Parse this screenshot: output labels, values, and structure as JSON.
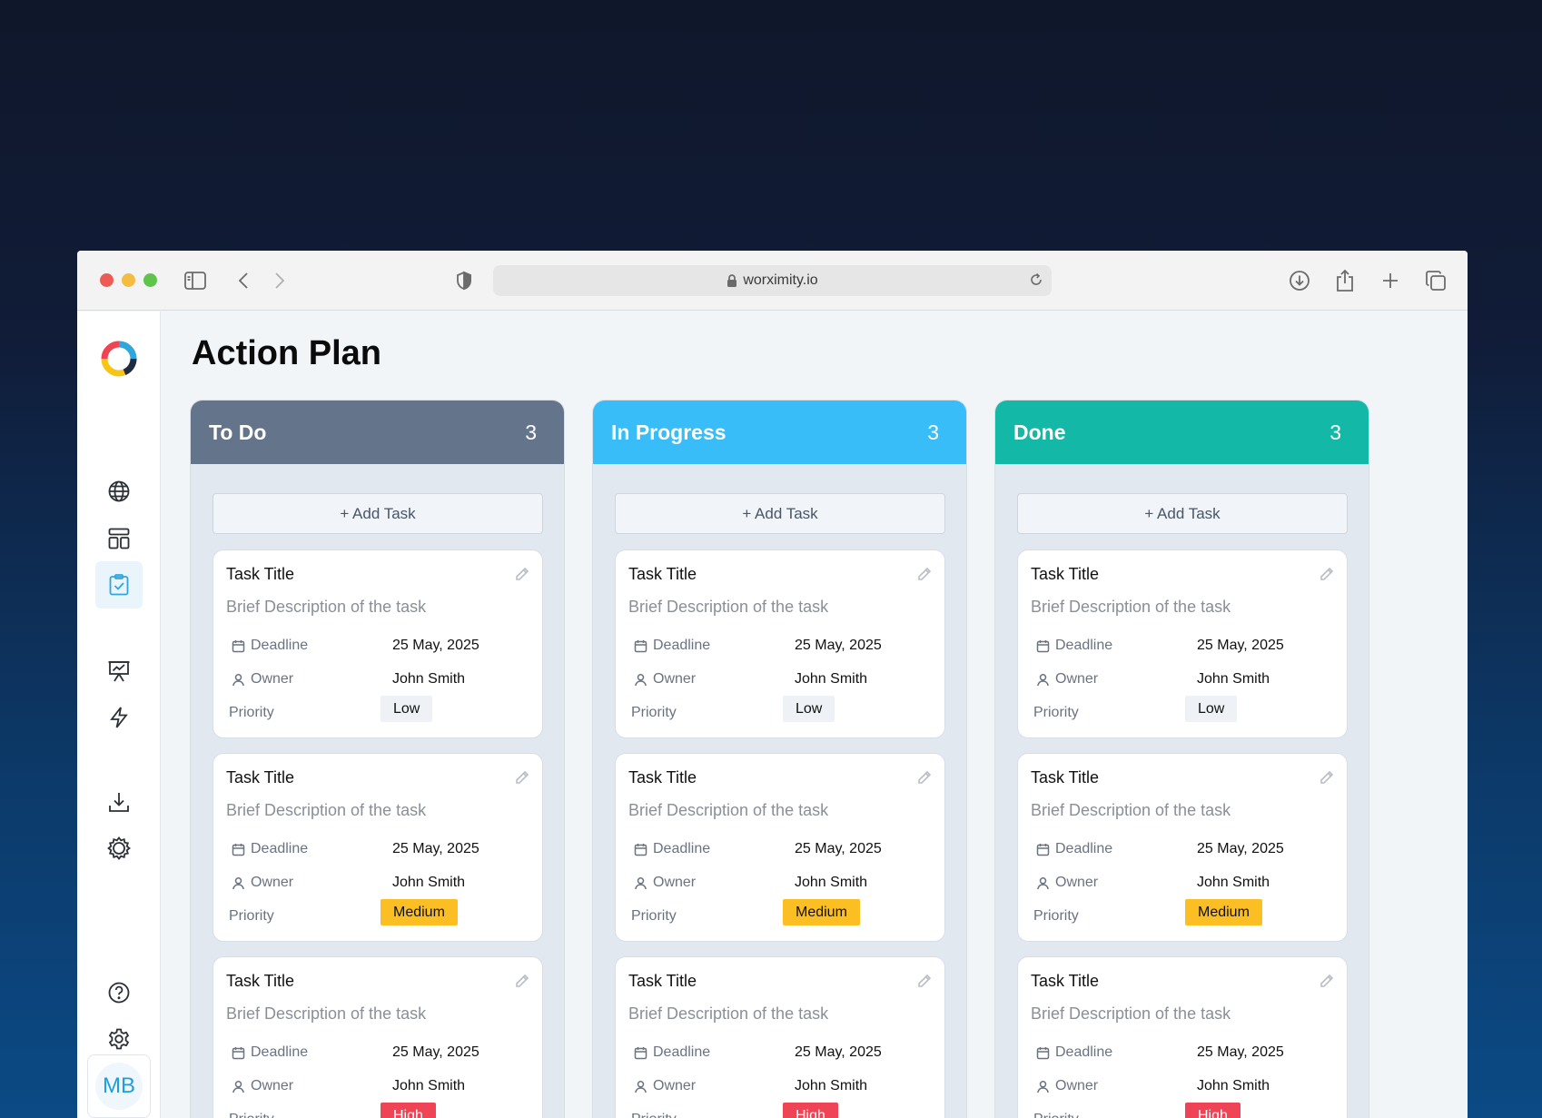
{
  "browser": {
    "url": "worximity.io"
  },
  "page": {
    "title": "Action Plan"
  },
  "user": {
    "initials": "MB"
  },
  "colors": {
    "todo": "#64748b",
    "in_progress": "#38bdf8",
    "done": "#14b8a6",
    "low": "#eef2f6",
    "medium": "#fbbf24",
    "high": "#ef4456"
  },
  "sidebar": {
    "items": [
      {
        "icon": "globe-icon"
      },
      {
        "icon": "layout-icon"
      },
      {
        "icon": "clipboard-check-icon",
        "active": true
      },
      {
        "icon": "presentation-chart-icon"
      },
      {
        "icon": "lightning-icon"
      },
      {
        "icon": "download-icon"
      },
      {
        "icon": "gear-badge-icon"
      },
      {
        "icon": "help-icon"
      },
      {
        "icon": "settings-icon"
      }
    ]
  },
  "columns": [
    {
      "name": "To Do",
      "count": "3",
      "add_label": "+ Add Task",
      "cards": [
        {
          "title": "Task Title",
          "description": "Brief Description of the task",
          "deadline_label": "Deadline",
          "deadline": "25 May, 2025",
          "owner_label": "Owner",
          "owner": "John Smith",
          "priority_label": "Priority",
          "priority": "Low"
        },
        {
          "title": "Task Title",
          "description": "Brief Description of the task",
          "deadline_label": "Deadline",
          "deadline": "25 May, 2025",
          "owner_label": "Owner",
          "owner": "John Smith",
          "priority_label": "Priority",
          "priority": "Medium"
        },
        {
          "title": "Task Title",
          "description": "Brief Description of the task",
          "deadline_label": "Deadline",
          "deadline": "25 May, 2025",
          "owner_label": "Owner",
          "owner": "John Smith",
          "priority_label": "Priority",
          "priority": "High"
        }
      ]
    },
    {
      "name": "In Progress",
      "count": "3",
      "add_label": "+ Add Task",
      "cards": [
        {
          "title": "Task Title",
          "description": "Brief Description of the task",
          "deadline_label": "Deadline",
          "deadline": "25 May, 2025",
          "owner_label": "Owner",
          "owner": "John Smith",
          "priority_label": "Priority",
          "priority": "Low"
        },
        {
          "title": "Task Title",
          "description": "Brief Description of the task",
          "deadline_label": "Deadline",
          "deadline": "25 May, 2025",
          "owner_label": "Owner",
          "owner": "John Smith",
          "priority_label": "Priority",
          "priority": "Medium"
        },
        {
          "title": "Task Title",
          "description": "Brief Description of the task",
          "deadline_label": "Deadline",
          "deadline": "25 May, 2025",
          "owner_label": "Owner",
          "owner": "John Smith",
          "priority_label": "Priority",
          "priority": "High"
        }
      ]
    },
    {
      "name": "Done",
      "count": "3",
      "add_label": "+ Add Task",
      "cards": [
        {
          "title": "Task Title",
          "description": "Brief Description of the task",
          "deadline_label": "Deadline",
          "deadline": "25 May, 2025",
          "owner_label": "Owner",
          "owner": "John Smith",
          "priority_label": "Priority",
          "priority": "Low"
        },
        {
          "title": "Task Title",
          "description": "Brief Description of the task",
          "deadline_label": "Deadline",
          "deadline": "25 May, 2025",
          "owner_label": "Owner",
          "owner": "John Smith",
          "priority_label": "Priority",
          "priority": "Medium"
        },
        {
          "title": "Task Title",
          "description": "Brief Description of the task",
          "deadline_label": "Deadline",
          "deadline": "25 May, 2025",
          "owner_label": "Owner",
          "owner": "John Smith",
          "priority_label": "Priority",
          "priority": "High"
        }
      ]
    }
  ]
}
